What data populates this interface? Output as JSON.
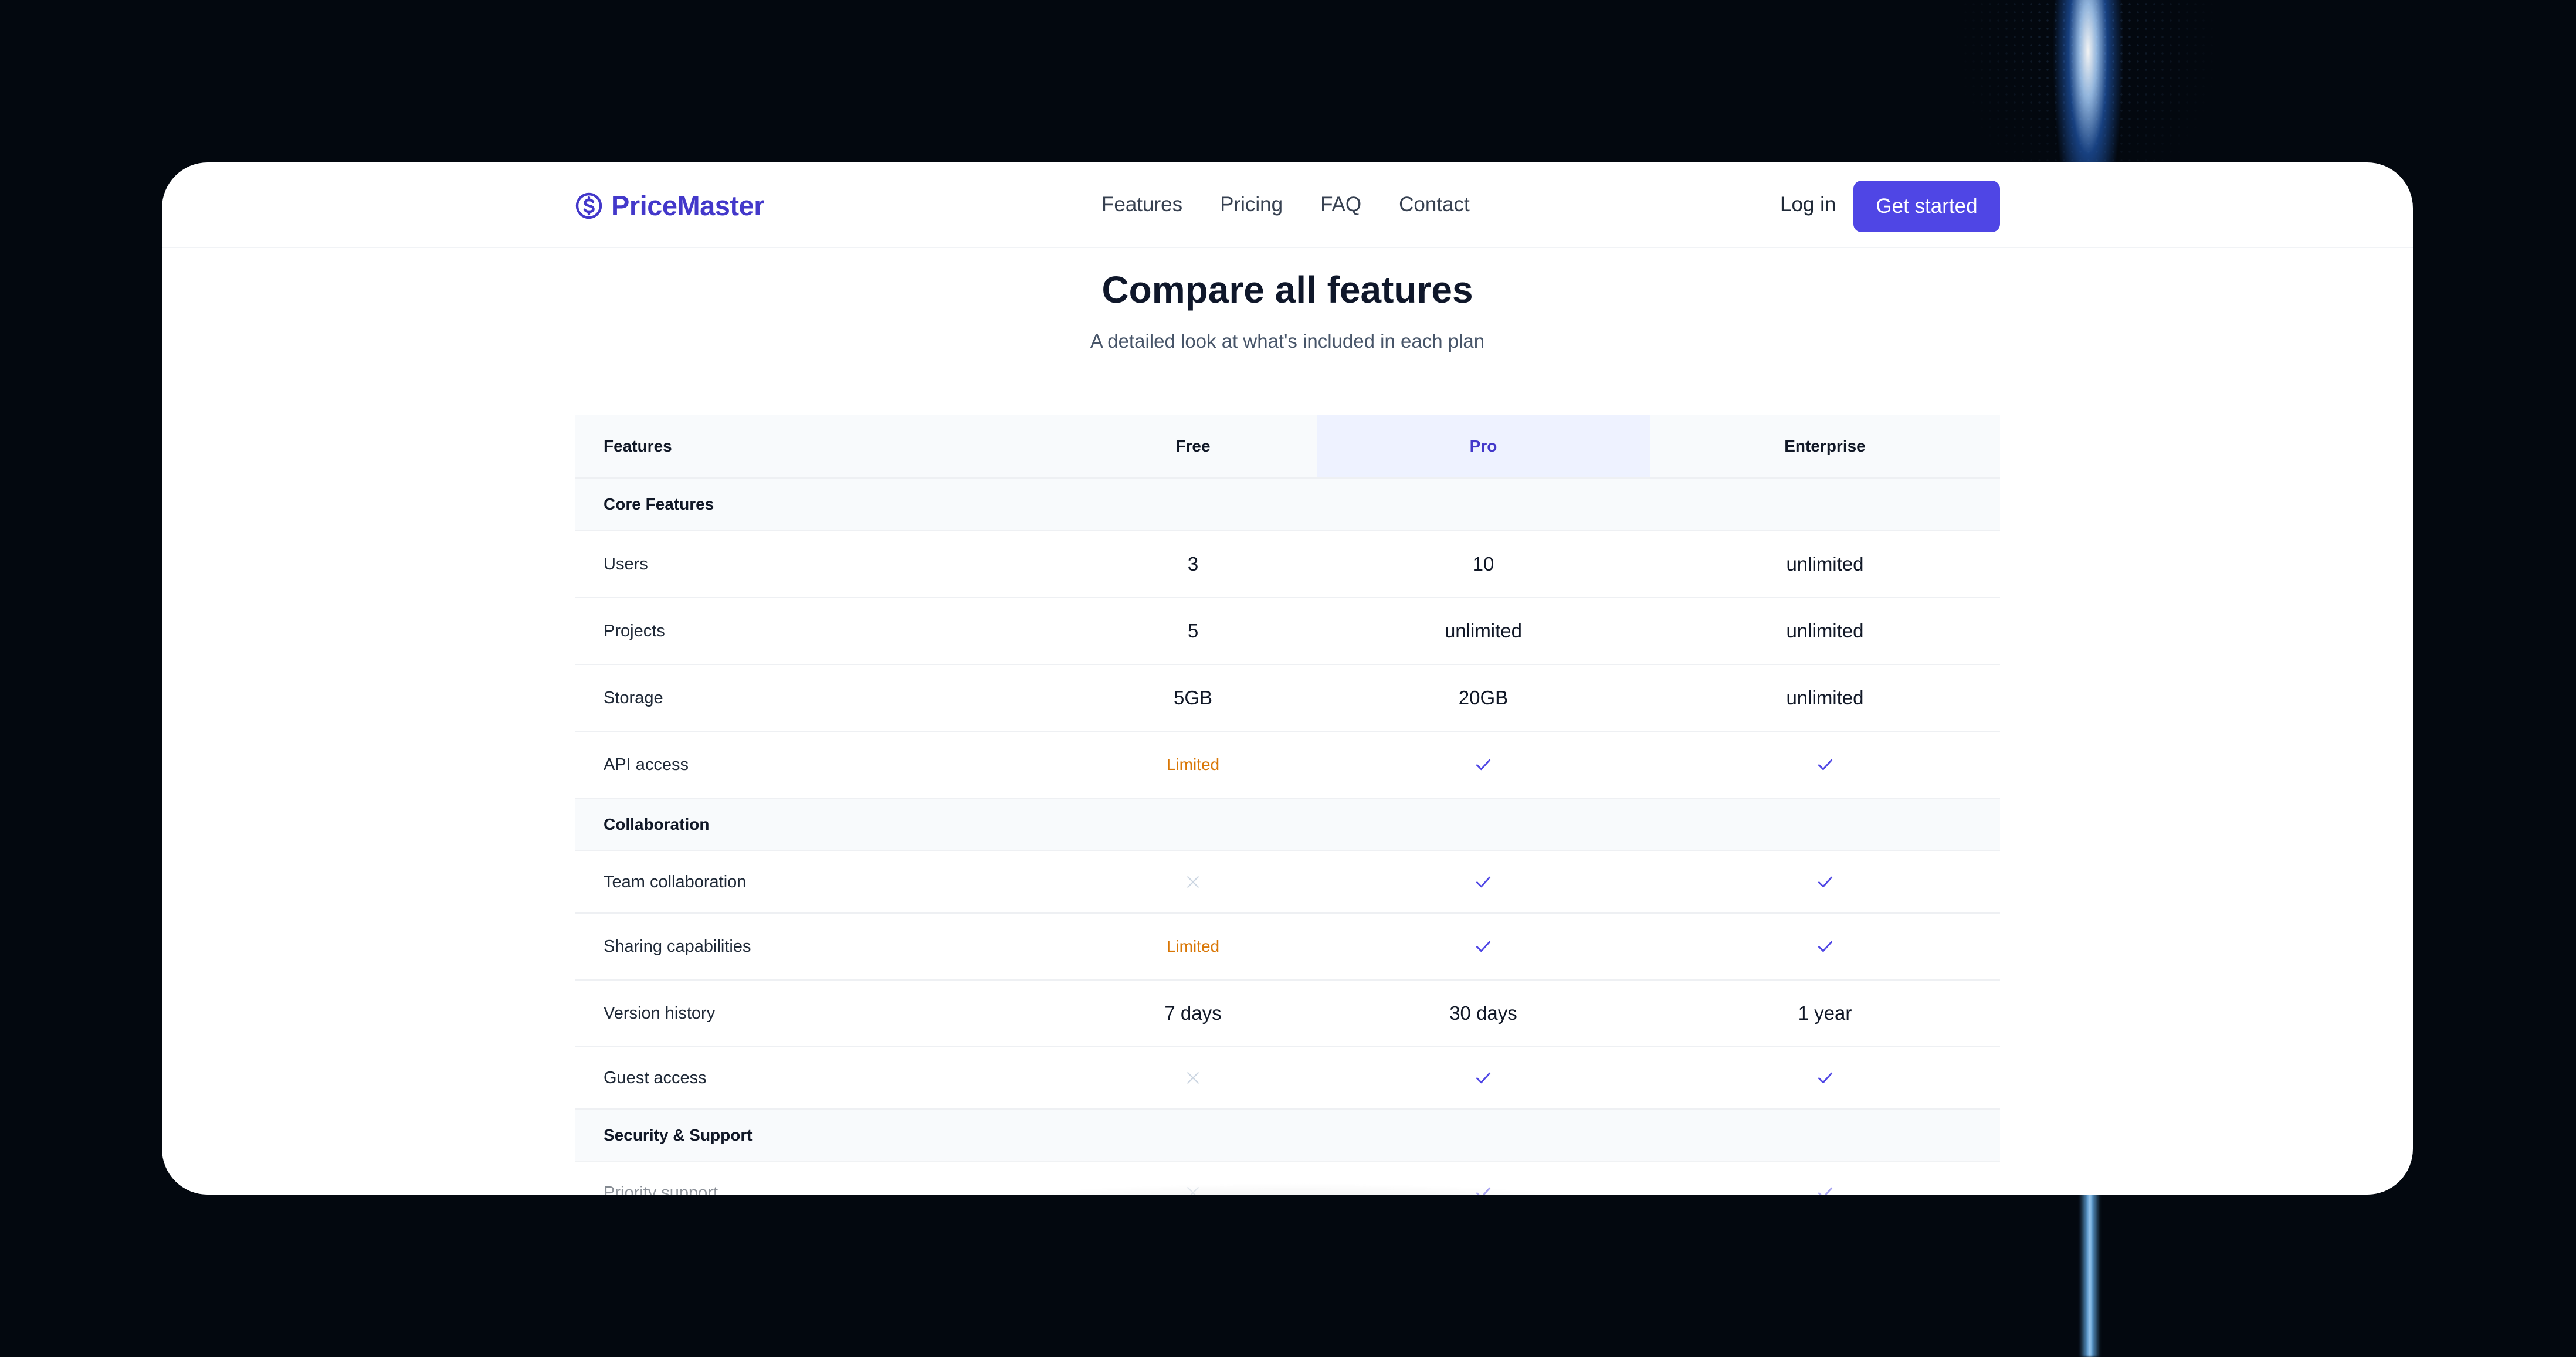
{
  "brand": {
    "name": "PriceMaster",
    "icon": "dollar-circle-icon",
    "color": "#4338ca"
  },
  "nav": {
    "links": [
      "Features",
      "Pricing",
      "FAQ",
      "Contact"
    ],
    "login_label": "Log in",
    "cta_label": "Get started",
    "cta_color": "#4f46e5"
  },
  "page": {
    "title": "Compare all features",
    "subtitle": "A detailed look at what's included in each plan"
  },
  "table": {
    "headers": [
      "Features",
      "Free",
      "Pro",
      "Enterprise"
    ],
    "highlight_color": "#eef2ff",
    "sections": [
      {
        "name": "Core Features",
        "rows": [
          {
            "feature": "Users",
            "free": "3",
            "pro": "10",
            "enterprise": "unlimited"
          },
          {
            "feature": "Projects",
            "free": "5",
            "pro": "unlimited",
            "enterprise": "unlimited"
          },
          {
            "feature": "Storage",
            "free": "5GB",
            "pro": "20GB",
            "enterprise": "unlimited"
          },
          {
            "feature": "API access",
            "free": "Limited",
            "pro": "check-icon",
            "enterprise": "check-icon"
          }
        ]
      },
      {
        "name": "Collaboration",
        "rows": [
          {
            "feature": "Team collaboration",
            "free": "cross-icon",
            "pro": "check-icon",
            "enterprise": "check-icon"
          },
          {
            "feature": "Sharing capabilities",
            "free": "Limited",
            "pro": "check-icon",
            "enterprise": "check-icon"
          },
          {
            "feature": "Version history",
            "free": "7 days",
            "pro": "30 days",
            "enterprise": "1 year"
          },
          {
            "feature": "Guest access",
            "free": "cross-icon",
            "pro": "check-icon",
            "enterprise": "check-icon"
          }
        ]
      },
      {
        "name": "Security & Support",
        "rows": [
          {
            "feature": "Priority support",
            "free": "cross-icon",
            "pro": "check-icon",
            "enterprise": "check-icon"
          }
        ]
      }
    ]
  },
  "colors": {
    "limited": "#d97706",
    "check": "#4f46e5",
    "cross": "#cbd5e1"
  }
}
